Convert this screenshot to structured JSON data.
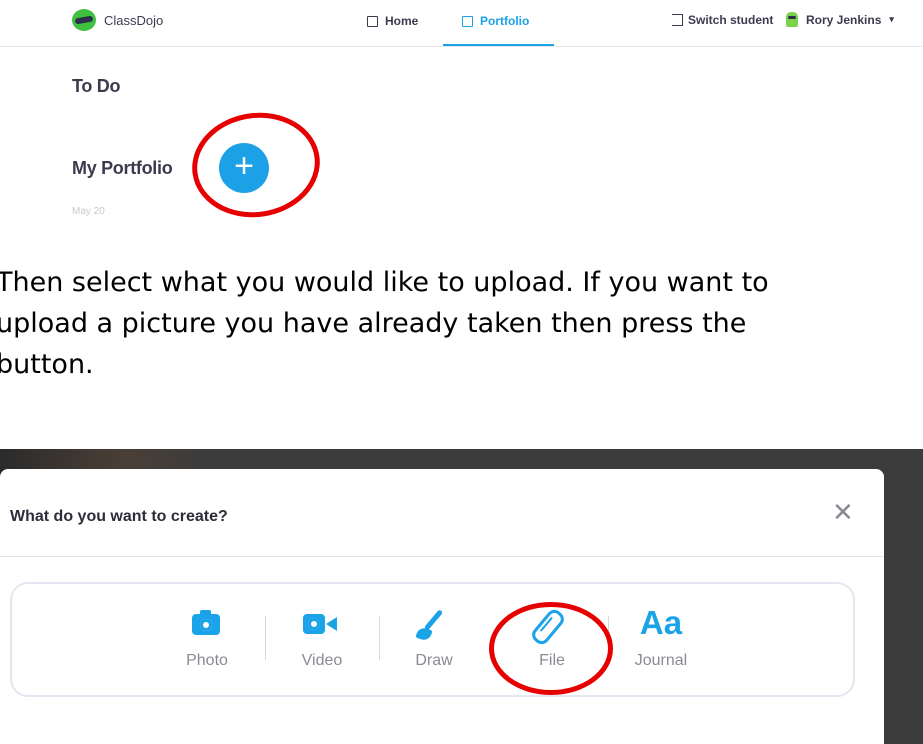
{
  "top": {
    "brand": "ClassDojo",
    "nav": {
      "home": "Home",
      "portfolio": "Portfolio"
    },
    "switch_student": "Switch student",
    "user_name": "Rory Jenkins",
    "todo_heading": "To Do",
    "portfolio_heading": "My Portfolio",
    "date_fragment": "May 20",
    "plus": "+",
    "accent": "#1aa3e8",
    "highlight": "#e60000"
  },
  "instructions": [
    "Then select what you would like to upload. If you want to",
    "upload a picture you have already taken then press the",
    "button."
  ],
  "dialog": {
    "title": "What do you want to create?",
    "close": "✕",
    "options": [
      {
        "label": "Photo",
        "icon": "camera-icon"
      },
      {
        "label": "Video",
        "icon": "video-camera-icon"
      },
      {
        "label": "Draw",
        "icon": "paintbrush-icon"
      },
      {
        "label": "File",
        "icon": "paperclip-icon"
      },
      {
        "label": "Journal",
        "icon": "text-aa-icon",
        "glyph": "Aa"
      }
    ]
  }
}
